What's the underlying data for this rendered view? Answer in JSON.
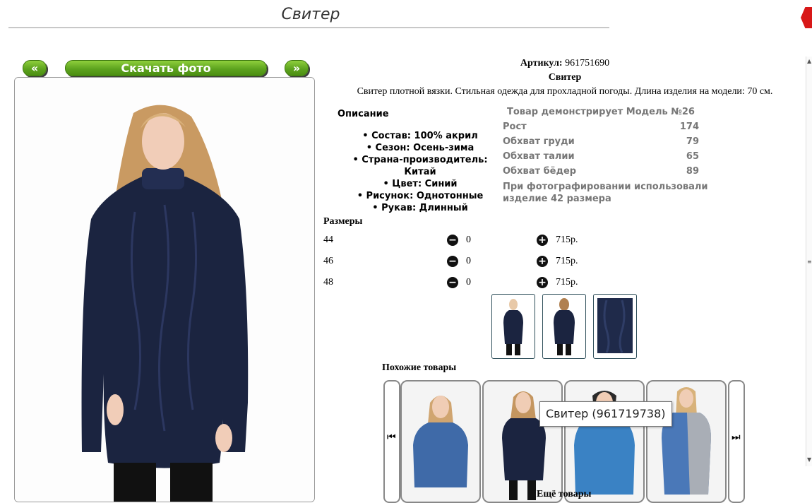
{
  "page": {
    "title": "Свитер"
  },
  "nav": {
    "prev_label": "«",
    "download_label": "Скачать фото",
    "next_label": "»"
  },
  "product": {
    "article_label": "Артикул:",
    "article_value": "961751690",
    "name": "Свитер",
    "summary": "Свитер плотной вязки. Стильная одежда для прохладной погоды. Длина изделия на модели: 70 см."
  },
  "description": {
    "heading": "Описание",
    "items": [
      "• Состав: 100% акрил",
      "• Сезон: Осень-зима",
      "• Страна-производитель: Китай",
      "• Цвет: Синий",
      "• Рисунок: Однотонные",
      "• Рукав: Длинный"
    ]
  },
  "model": {
    "title": "Товар демонстрирует Модель №26",
    "rows": [
      {
        "label": "Рост",
        "value": "174"
      },
      {
        "label": "Обхват груди",
        "value": "79"
      },
      {
        "label": "Обхват талии",
        "value": "65"
      },
      {
        "label": "Обхват бёдер",
        "value": "89"
      }
    ],
    "note": "При фотографировании использовали изделие 42 размера"
  },
  "sizes": {
    "heading": "Размеры",
    "rows": [
      {
        "size": "44",
        "qty": "0",
        "price": "715р."
      },
      {
        "size": "46",
        "qty": "0",
        "price": "715р."
      },
      {
        "size": "48",
        "qty": "0",
        "price": "715р."
      }
    ]
  },
  "similar": {
    "heading": "Похожие товары",
    "tooltip": "Свитер (961719738)",
    "more_label": "Ещё товары"
  },
  "icons": {
    "minus": "minus-circle-icon",
    "plus": "plus-circle-icon",
    "prev": "skip-back-icon",
    "next": "skip-forward-icon",
    "close": "close-icon"
  },
  "colors": {
    "accent_green": "#5da31e",
    "close_red": "#d81818",
    "sweater_navy": "#1b2440",
    "sweater_blue": "#3f6aa8"
  }
}
